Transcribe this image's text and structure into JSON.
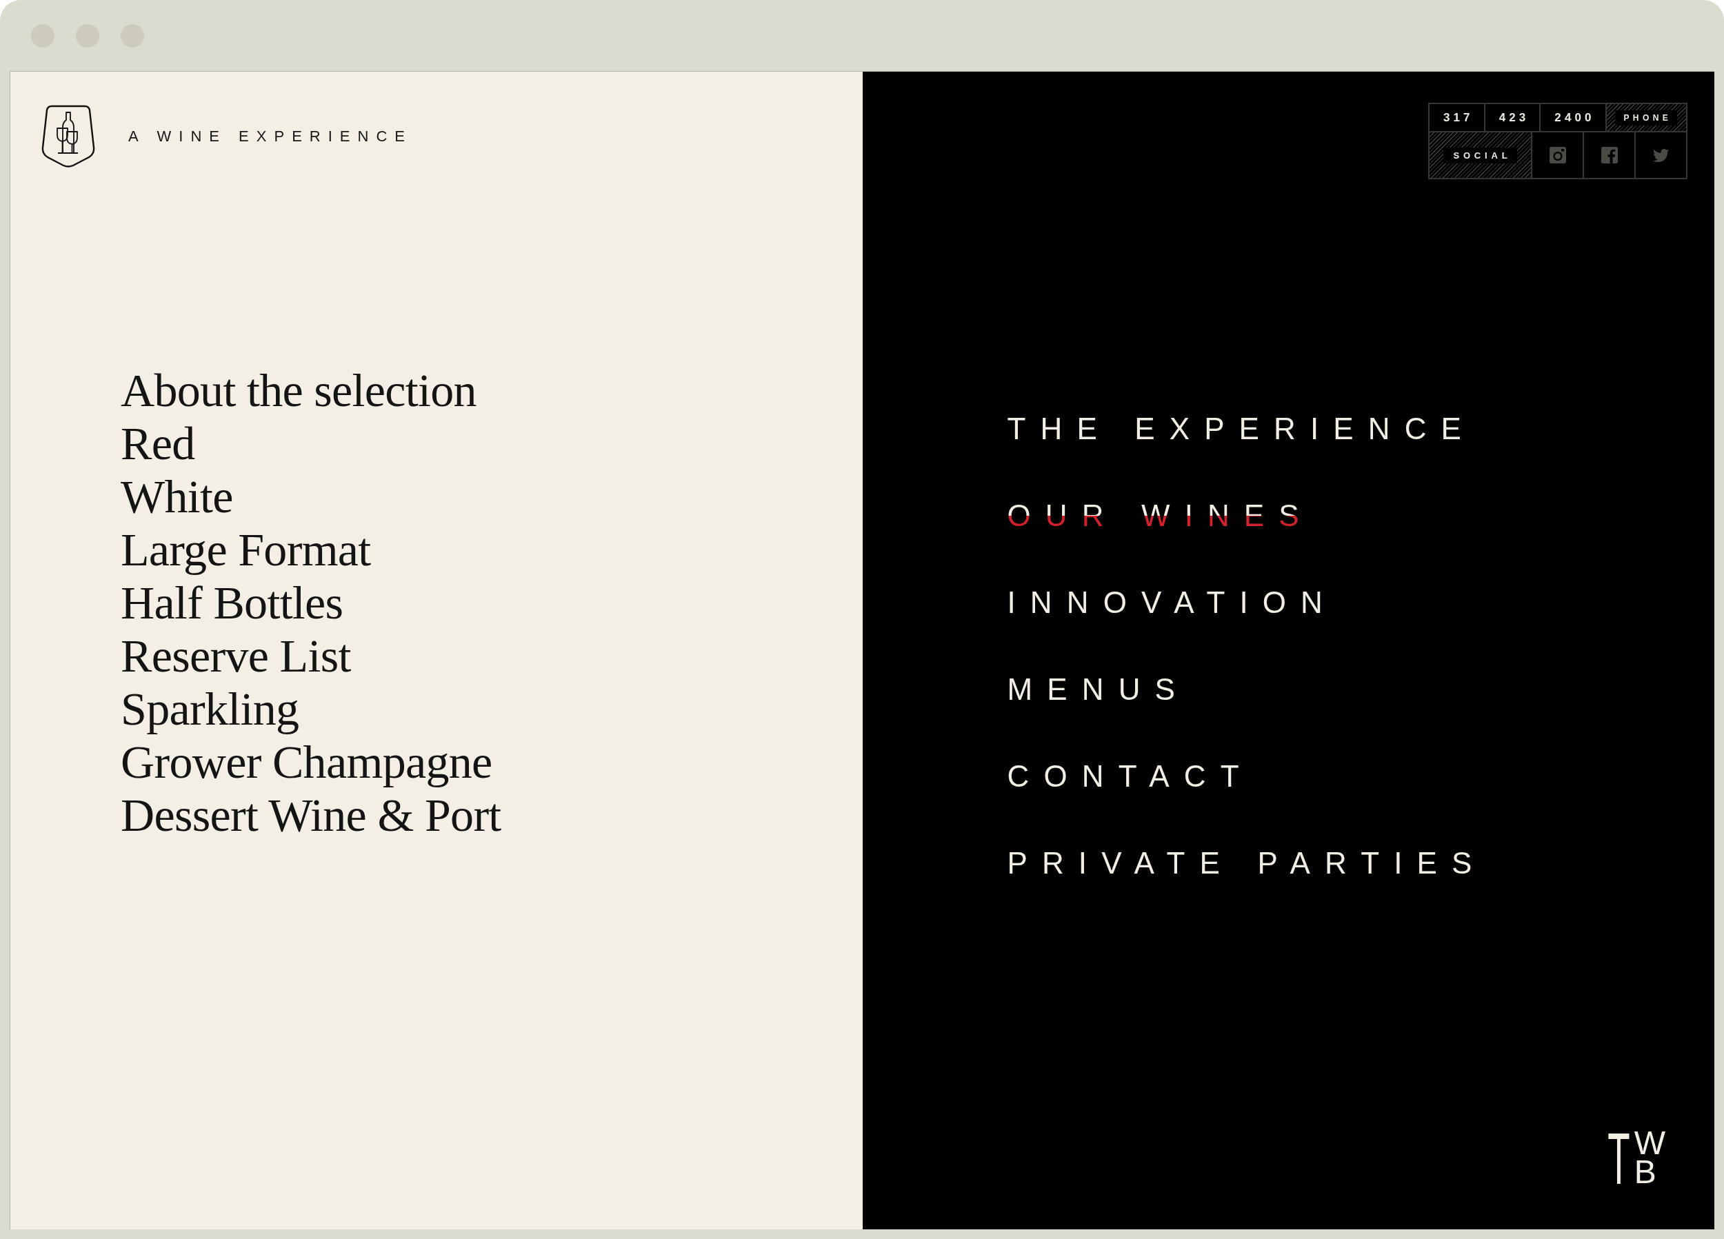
{
  "header": {
    "tagline": "A WINE EXPERIENCE"
  },
  "wine_menu": {
    "items": [
      "About the selection",
      "Red",
      "White",
      "Large Format",
      "Half Bottles",
      "Reserve List",
      "Sparkling",
      "Grower Champagne",
      "Dessert Wine & Port"
    ]
  },
  "contact_panel": {
    "phone": {
      "parts": [
        "317",
        "423",
        "2400"
      ],
      "label": "PHONE"
    },
    "social": {
      "label": "SOCIAL",
      "links": [
        {
          "kind": "instagram"
        },
        {
          "kind": "facebook"
        },
        {
          "kind": "twitter"
        }
      ]
    }
  },
  "main_nav": {
    "items": [
      {
        "label": "THE EXPERIENCE",
        "selected": false
      },
      {
        "label": "OUR WINES",
        "selected": true
      },
      {
        "label": "INNOVATION",
        "selected": false
      },
      {
        "label": "MENUS",
        "selected": false
      },
      {
        "label": "CONTACT",
        "selected": false
      },
      {
        "label": "PRIVATE PARTIES",
        "selected": false
      }
    ]
  },
  "monogram": {
    "large": "T",
    "top": "W",
    "bottom": "B"
  }
}
